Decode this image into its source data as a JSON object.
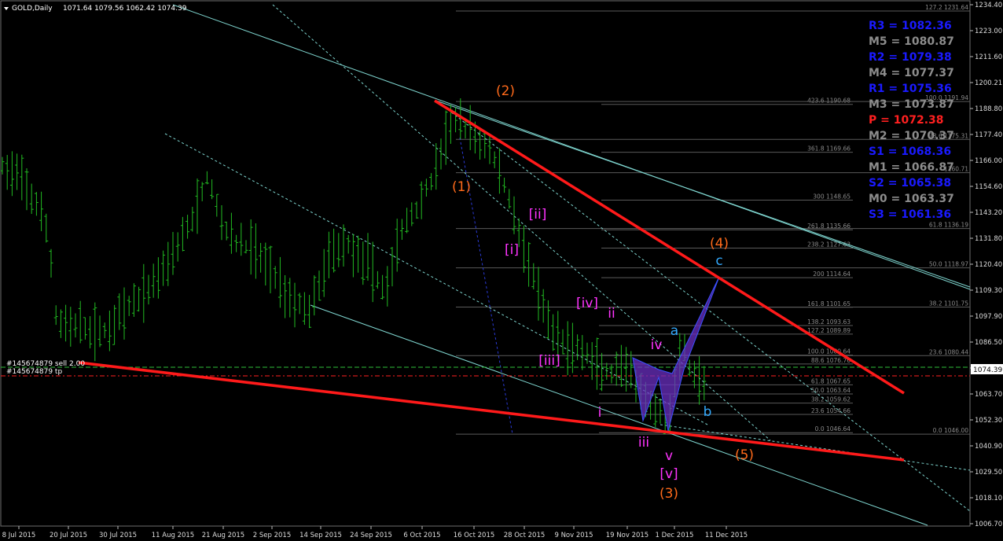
{
  "chart_data": {
    "type": "ohlc",
    "symbol_header": "GOLD,Daily",
    "header_ohlc": "1071.64 1079.56 1062.42 1074.39",
    "current_price": "1074.39",
    "ylim": [
      1006.7,
      1234.4
    ],
    "y_ticks": [
      "1234.40",
      "1223.00",
      "1211.60",
      "1200.21",
      "1188.80",
      "1177.40",
      "1166.00",
      "1154.60",
      "1143.20",
      "1131.80",
      "1120.40",
      "1109.30",
      "1097.90",
      "1086.50",
      "1075.10",
      "1063.70",
      "1052.30",
      "1040.90",
      "1029.50",
      "1018.10",
      "1006.70"
    ],
    "x_ticks": [
      "8 Jul 2015",
      "20 Jul 2015",
      "30 Jul 2015",
      "11 Aug 2015",
      "21 Aug 2015",
      "2 Sep 2015",
      "14 Sep 2015",
      "24 Sep 2015",
      "6 Oct 2015",
      "16 Oct 2015",
      "28 Oct 2015",
      "9 Nov 2015",
      "19 Nov 2015",
      "1 Dec 2015",
      "11 Dec 2015"
    ],
    "order_labels": [
      "#145674879 sell 2.00",
      "#145674879 tp"
    ],
    "pivot_levels": [
      {
        "label": "R3 = 1082.36",
        "color": "#1a1aff"
      },
      {
        "label": "M5 = 1080.87",
        "color": "#8c8c8c"
      },
      {
        "label": "R2 = 1079.38",
        "color": "#1a1aff"
      },
      {
        "label": "M4 = 1077.37",
        "color": "#8c8c8c"
      },
      {
        "label": "R1 = 1075.36",
        "color": "#1a1aff"
      },
      {
        "label": "M3 = 1073.87",
        "color": "#8c8c8c"
      },
      {
        "label": "P   = 1072.38",
        "color": "#ff2020"
      },
      {
        "label": "M2 = 1070.37",
        "color": "#8c8c8c"
      },
      {
        "label": "S1 = 1068.36",
        "color": "#1a1aff"
      },
      {
        "label": "M1 = 1066.87",
        "color": "#8c8c8c"
      },
      {
        "label": "S2 = 1065.38",
        "color": "#1a1aff"
      },
      {
        "label": "M0 = 1063.37",
        "color": "#8c8c8c"
      },
      {
        "label": "S3 = 1061.36",
        "color": "#1a1aff"
      }
    ],
    "fib_levels_mid": [
      {
        "text": "423.6 1190.68",
        "price": 1190.68
      },
      {
        "text": "361.8 1169.66",
        "price": 1169.66
      },
      {
        "text": "300 1148.65",
        "price": 1148.65
      },
      {
        "text": "261.8 1135.66",
        "price": 1135.66
      },
      {
        "text": "238.2 1127.63",
        "price": 1127.63
      },
      {
        "text": "200 1114.64",
        "price": 1114.64
      },
      {
        "text": "161.8 1101.65",
        "price": 1101.65
      },
      {
        "text": "138.2 1093.63",
        "price": 1093.63
      },
      {
        "text": "127.2 1089.89",
        "price": 1089.89
      },
      {
        "text": "100.0 1080.64",
        "price": 1080.64
      },
      {
        "text": "88.6 1076.76",
        "price": 1076.76
      },
      {
        "text": "61.8 1067.65",
        "price": 1067.65
      },
      {
        "text": "50.0 1063.64",
        "price": 1063.64
      },
      {
        "text": "38.2 1059.62",
        "price": 1059.62
      },
      {
        "text": "23.6 1054.66",
        "price": 1054.66
      },
      {
        "text": "0.0 1046.64",
        "price": 1046.64
      }
    ],
    "fib_levels_right": [
      {
        "text": "127.2 1231.64",
        "price": 1231.64
      },
      {
        "text": "100.0 1191.94",
        "price": 1191.94
      },
      {
        "text": "78.6 1175.31",
        "price": 1175.31
      },
      {
        "text": "1160.71",
        "price": 1160.71
      },
      {
        "text": "61.8 1136.19",
        "price": 1136.19
      },
      {
        "text": "50.0 1118.97",
        "price": 1118.97
      },
      {
        "text": "38.2 1101.75",
        "price": 1101.75
      },
      {
        "text": "23.6 1080.44",
        "price": 1080.44
      },
      {
        "text": "0.0 1046.00",
        "price": 1046.0
      }
    ],
    "wave_labels": [
      {
        "text": "(2)",
        "color": "#ff6a1a"
      },
      {
        "text": "(1)",
        "color": "#ff6a1a"
      },
      {
        "text": "[ii]",
        "color": "#ff33ff"
      },
      {
        "text": "[i]",
        "color": "#ff33ff"
      },
      {
        "text": "[iv]",
        "color": "#ff33ff"
      },
      {
        "text": "ii",
        "color": "#ff33ff"
      },
      {
        "text": "[iii]",
        "color": "#ff33ff"
      },
      {
        "text": "a",
        "color": "#33aaff"
      },
      {
        "text": "iv",
        "color": "#ff33ff"
      },
      {
        "text": "i",
        "color": "#ff33ff"
      },
      {
        "text": "iii",
        "color": "#ff33ff"
      },
      {
        "text": "v",
        "color": "#ff33ff"
      },
      {
        "text": "[v]",
        "color": "#ff33ff"
      },
      {
        "text": "(3)",
        "color": "#ff6a1a"
      },
      {
        "text": "(4)",
        "color": "#ff6a1a"
      },
      {
        "text": "c",
        "color": "#33aaff"
      },
      {
        "text": "b",
        "color": "#33aaff"
      },
      {
        "text": "(5)",
        "color": "#ff6a1a"
      }
    ],
    "colors": {
      "background": "#000000",
      "bars": "#22bb22",
      "trend_red": "#ff1a1a",
      "channel": "#7fd6d0",
      "fib_line": "#5a5a5a",
      "butterfly": "#6a2fc0"
    }
  }
}
